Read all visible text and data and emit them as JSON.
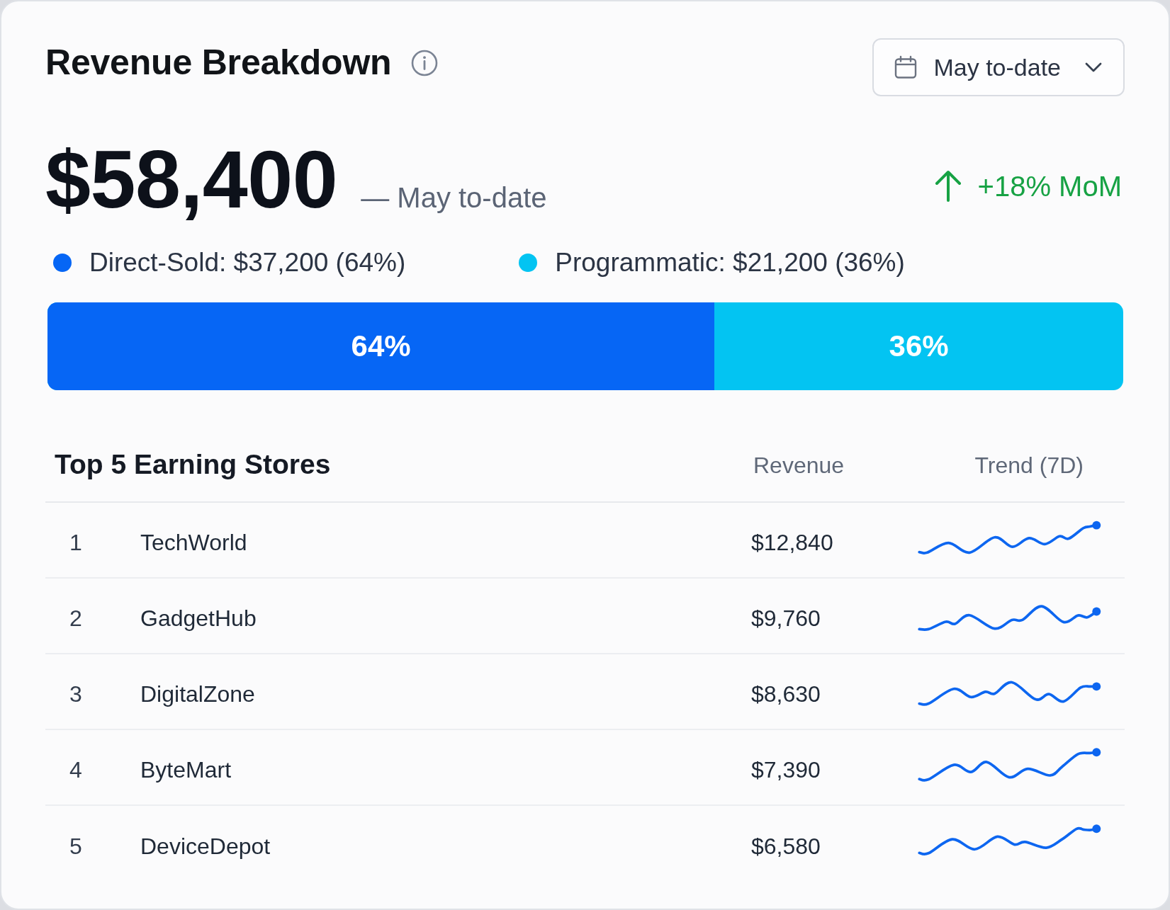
{
  "card": {
    "title": "Revenue Breakdown",
    "period_button": {
      "label": "May to-date"
    }
  },
  "total": {
    "amount": "$58,400",
    "period": "— May to-date",
    "change": "+18% MoM"
  },
  "legend": [
    {
      "label": "Direct-Sold: $37,200 (64%)",
      "color": "#0666f5"
    },
    {
      "label": "Programmatic: $21,200 (36%)",
      "color": "#03c4f2"
    }
  ],
  "split_bar": {
    "level": 0.62,
    "labels": [
      "64%",
      "36%"
    ]
  },
  "stores": {
    "title": "Top 5 Earning Stores",
    "columns": [
      "Revenue",
      "Trend (7D)"
    ],
    "rows": [
      {
        "rank": "1",
        "name": "TechWorld",
        "revenue": "$12,840"
      },
      {
        "rank": "2",
        "name": "GadgetHub",
        "revenue": "$9,760"
      },
      {
        "rank": "3",
        "name": "DigitalZone",
        "revenue": "$8,630"
      },
      {
        "rank": "4",
        "name": "ByteMart",
        "revenue": "$7,390"
      },
      {
        "rank": "5",
        "name": "DeviceDepot",
        "revenue": "$6,580"
      }
    ]
  }
}
